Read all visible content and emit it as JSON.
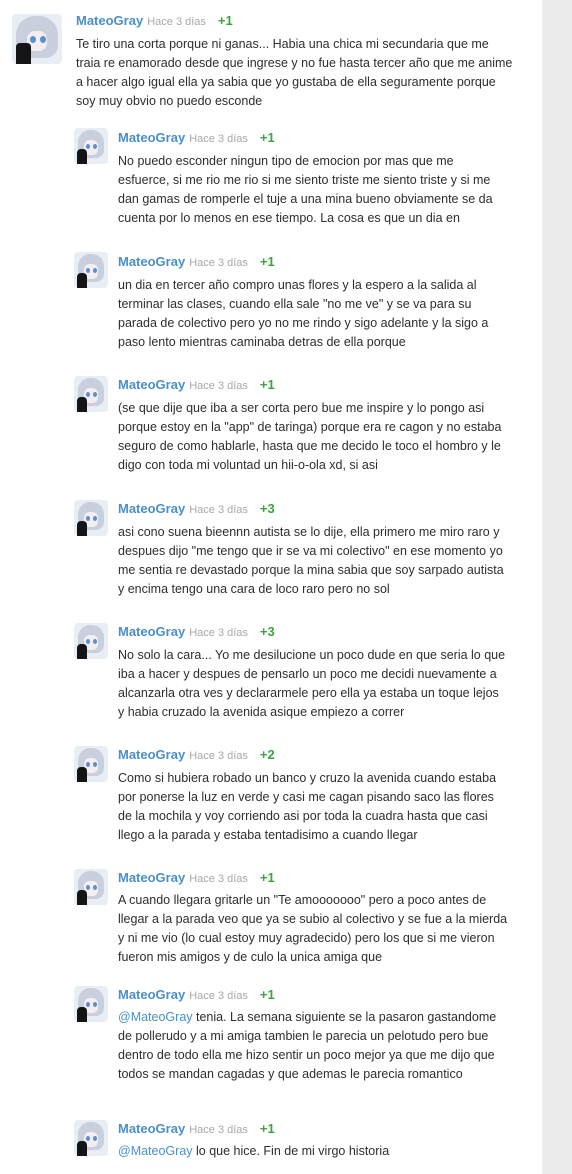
{
  "scrollbar_color": "#ececec",
  "accent_color": "#4a90c8",
  "vote_color": "#39a53c",
  "comments": [
    {
      "user": "MateoGray",
      "time": "Hace 3 días",
      "votes": "+1",
      "text": "Te tiro una corta porque ni ganas... Habia una chica mi secundaria que me traia re enamorado desde que ingrese y no fue hasta tercer año que me anime a hacer algo igual ella ya sabia que yo gustaba de ella seguramente porque soy muy obvio no puedo esconde"
    },
    {
      "user": "MateoGray",
      "time": "Hace 3 días",
      "votes": "+1",
      "text": "No puedo esconder ningun tipo de emocion por mas que me esfuerce, si me rio me rio si me siento triste me siento triste y si me dan gamas de romperle el tuje a una mina bueno obviamente se da cuenta por lo menos en ese tiempo. La cosa es que un dia en"
    },
    {
      "user": "MateoGray",
      "time": "Hace 3 días",
      "votes": "+1",
      "text": "un dia en tercer año compro unas flores y la espero a la salida al terminar las clases, cuando ella sale \"no me ve\" y se va para su parada de colectivo pero yo no me rindo y sigo adelante y la sigo a paso lento mientras caminaba detras de ella porque"
    },
    {
      "user": "MateoGray",
      "time": "Hace 3 días",
      "votes": "+1",
      "text": "(se que dije que iba a ser corta pero bue me inspire y lo pongo asi porque estoy en la \"app\" de taringa) porque era re cagon y no estaba seguro de como hablarle, hasta que me decido le toco el hombro y le digo con toda mi voluntad un hii-o-ola xd, si asi"
    },
    {
      "user": "MateoGray",
      "time": "Hace 3 días",
      "votes": "+3",
      "text": "asi cono suena bieennn autista se lo dije, ella primero me miro raro y despues dijo \"me tengo que ir se va mi colectivo\" en ese momento yo me sentia re devastado porque la mina sabia que soy sarpado autista y encima tengo una cara de loco raro pero no sol"
    },
    {
      "user": "MateoGray",
      "time": "Hace 3 días",
      "votes": "+3",
      "text": "No solo la cara... Yo me desilucione un poco dude en que seria lo que iba a hacer y despues de pensarlo un poco me decidi nuevamente a alcanzarla otra ves y declararmele pero ella ya estaba un toque lejos y habia cruzado la avenida asique empiezo a correr"
    },
    {
      "user": "MateoGray",
      "time": "Hace 3 días",
      "votes": "+2",
      "text": "Como si hubiera robado un banco y cruzo la avenida cuando estaba por ponerse la luz en verde y casi me cagan pisando saco las flores de la mochila y voy corriendo asi por toda la cuadra hasta que casi llego a la parada y estaba tentadisimo a cuando llegar"
    },
    {
      "user": "MateoGray",
      "time": "Hace 3 días",
      "votes": "+1",
      "text": "A cuando llegara gritarle un \"Te amooooooo\" pero a poco antes de llegar a la parada veo que ya se subio al colectivo y se fue a la mierda y ni me vio (lo cual estoy muy agradecido) pero los que si me vieron fueron mis amigos y de culo la unica amiga que"
    },
    {
      "user": "MateoGray",
      "time": "Hace 3 días",
      "votes": "+1",
      "mention": "@MateoGray",
      "text": " tenia. La semana siguiente se la pasaron gastandome de pollerudo y a mi amiga tambien le parecia un pelotudo pero bue dentro de todo ella me hizo sentir un poco mejor ya que me dijo que todos se mandan cagadas y que ademas le parecia romantico"
    },
    {
      "user": "MateoGray",
      "time": "Hace 3 días",
      "votes": "+1",
      "mention": "@MateoGray",
      "text": " lo que hice. Fin de mi virgo historia"
    }
  ]
}
